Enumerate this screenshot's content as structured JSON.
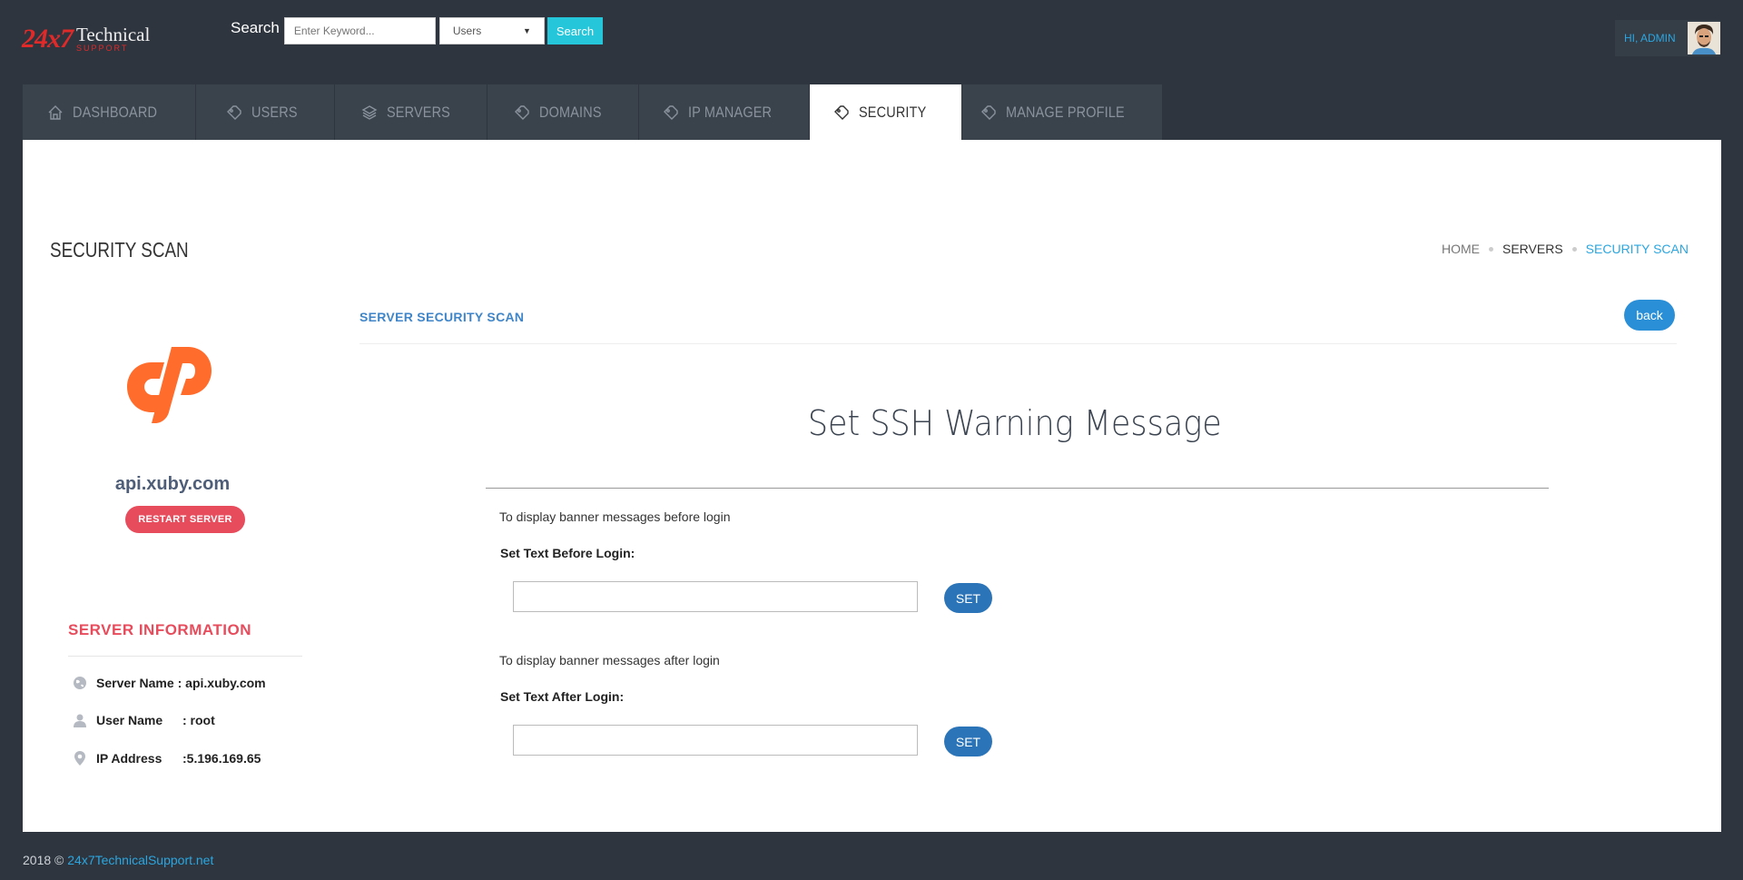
{
  "logo": {
    "number": "24x7",
    "name": "Technical",
    "tagline": "SUPPORT"
  },
  "search": {
    "label": "Search",
    "placeholder": "Enter Keyword...",
    "scope": "Users",
    "button": "Search"
  },
  "user": {
    "greeting": "HI, ADMIN"
  },
  "nav": {
    "items": [
      {
        "label": "DASHBOARD",
        "icon": "home-icon"
      },
      {
        "label": "USERS",
        "icon": "tag-icon"
      },
      {
        "label": "SERVERS",
        "icon": "layers-icon"
      },
      {
        "label": "DOMAINS",
        "icon": "tag-icon"
      },
      {
        "label": "IP MANAGER",
        "icon": "tag-icon"
      },
      {
        "label": "SECURITY",
        "icon": "tag-icon",
        "active": true
      },
      {
        "label": "MANAGE PROFILE",
        "icon": "tag-icon"
      }
    ]
  },
  "page": {
    "title": "SECURITY SCAN",
    "breadcrumb": [
      "HOME",
      "SERVERS",
      "SECURITY SCAN"
    ]
  },
  "server": {
    "host": "api.xuby.com",
    "restart_label": "RESTART SERVER",
    "info_title": "SERVER INFORMATION",
    "info": [
      {
        "key": "Server Name",
        "value": ": api.xuby.com",
        "icon": "globe-icon"
      },
      {
        "key": "User Name",
        "value": ": root",
        "icon": "user-icon"
      },
      {
        "key": "IP Address",
        "value": ":5.196.169.65",
        "icon": "map-pin-icon"
      }
    ]
  },
  "scan": {
    "section_title": "SERVER SECURITY SCAN",
    "back_label": "back",
    "heading": "Set SSH Warning Message",
    "before": {
      "desc": "To display banner messages before login",
      "label": "Set Text Before Login:",
      "value": "",
      "button": "SET"
    },
    "after": {
      "desc": "To display banner messages after login",
      "label": "Set Text After Login:",
      "value": "",
      "button": "SET"
    }
  },
  "footer": {
    "copyright": "2018 ©",
    "link": "24x7TechnicalSupport.net"
  },
  "colors": {
    "background": "#2e353e",
    "accent": "#2ba6e0",
    "danger": "#e74c5c",
    "button": "#2c74b8"
  }
}
